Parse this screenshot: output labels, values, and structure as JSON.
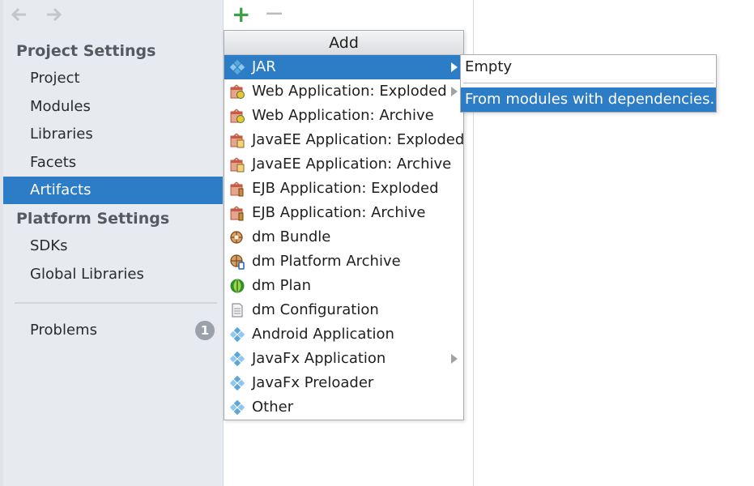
{
  "sidebar": {
    "project_settings_title": "Project Settings",
    "project_items": [
      {
        "label": "Project"
      },
      {
        "label": "Modules"
      },
      {
        "label": "Libraries"
      },
      {
        "label": "Facets"
      },
      {
        "label": "Artifacts",
        "selected": true
      }
    ],
    "platform_settings_title": "Platform Settings",
    "platform_items": [
      {
        "label": "SDKs"
      },
      {
        "label": "Global Libraries"
      }
    ],
    "problems_label": "Problems",
    "problems_count": "1"
  },
  "nav": {
    "back_icon": "arrow-left-icon",
    "forward_icon": "arrow-right-icon"
  },
  "toolbar": {
    "add_glyph": "+",
    "remove_glyph": "−"
  },
  "add_menu": {
    "title": "Add",
    "items": [
      {
        "label": "JAR",
        "icon": "artifact-diamond-icon",
        "selected": true,
        "has_submenu": true
      },
      {
        "label": "Web Application: Exploded",
        "icon": "web-app-icon",
        "has_submenu": true
      },
      {
        "label": "Web Application: Archive",
        "icon": "web-app-icon"
      },
      {
        "label": "JavaEE Application: Exploded",
        "icon": "javaee-app-icon"
      },
      {
        "label": "JavaEE Application: Archive",
        "icon": "javaee-app-icon"
      },
      {
        "label": "EJB Application: Exploded",
        "icon": "ejb-app-icon"
      },
      {
        "label": "EJB Application: Archive",
        "icon": "ejb-app-icon"
      },
      {
        "label": "dm Bundle",
        "icon": "dm-bundle-icon"
      },
      {
        "label": "dm Platform Archive",
        "icon": "dm-platform-archive-icon"
      },
      {
        "label": "dm Plan",
        "icon": "dm-plan-icon"
      },
      {
        "label": "dm Configuration",
        "icon": "document-icon"
      },
      {
        "label": "Android Application",
        "icon": "artifact-diamond-icon"
      },
      {
        "label": "JavaFx Application",
        "icon": "artifact-diamond-icon",
        "has_submenu": true
      },
      {
        "label": "JavaFx Preloader",
        "icon": "artifact-diamond-icon"
      },
      {
        "label": "Other",
        "icon": "artifact-diamond-icon"
      }
    ]
  },
  "jar_submenu": {
    "items": [
      {
        "label": "Empty"
      },
      {
        "label": "From modules with dependencies...",
        "selected": true
      }
    ]
  },
  "colors": {
    "selection": "#2c7cc6",
    "sidebar_bg": "#e7ebf0",
    "add_green": "#3ca04b",
    "diamond_blue": "#5aa7da"
  }
}
